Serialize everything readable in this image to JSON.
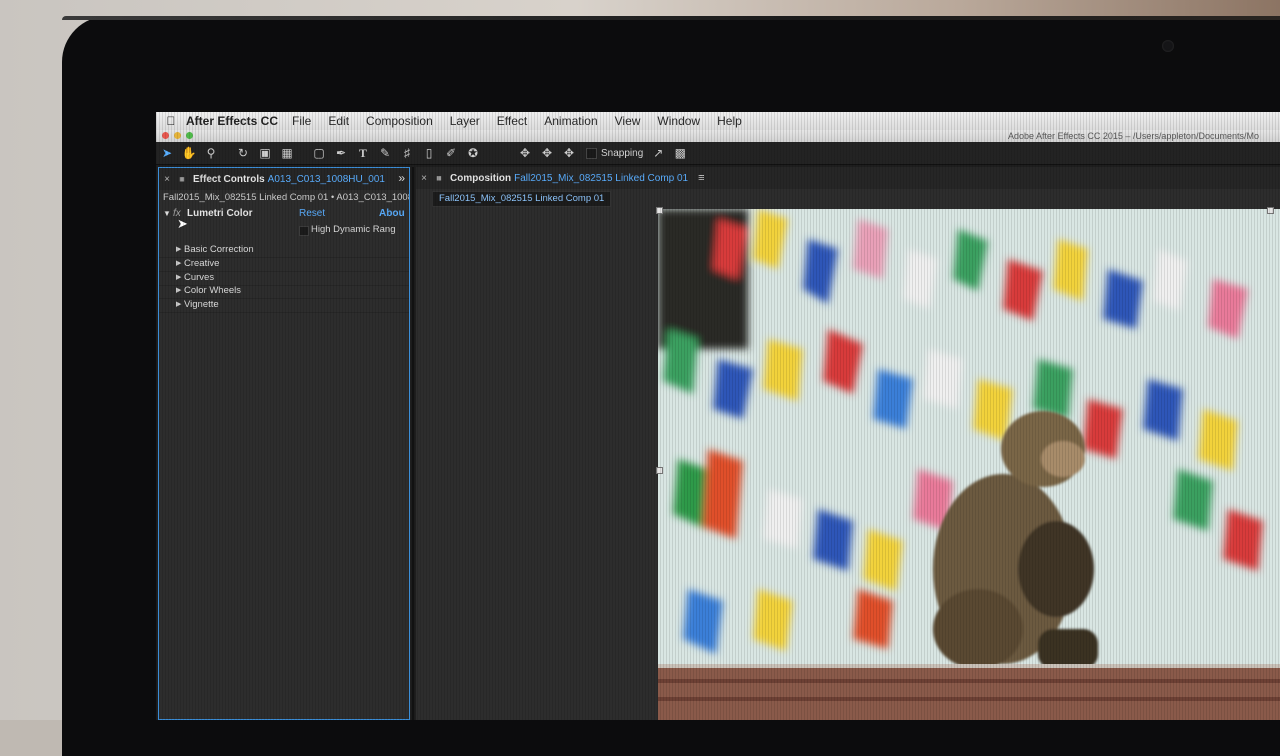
{
  "menubar": {
    "app_name": "After Effects CC",
    "items": [
      "File",
      "Edit",
      "Composition",
      "Layer",
      "Effect",
      "Animation",
      "View",
      "Window",
      "Help"
    ]
  },
  "window": {
    "title": "Adobe After Effects CC 2015 – /Users/appleton/Documents/Mo"
  },
  "toolbar": {
    "snapping_label": "Snapping",
    "snapping_enabled": false,
    "tools": [
      "selection-tool-icon",
      "hand-tool-icon",
      "zoom-tool-icon",
      "rotate-tool-icon",
      "camera-tool-icon",
      "pan-behind-tool-icon",
      "rectangle-tool-icon",
      "pen-tool-icon",
      "type-tool-icon",
      "brush-tool-icon",
      "clone-stamp-tool-icon",
      "eraser-tool-icon",
      "roto-brush-tool-icon",
      "puppet-pin-tool-icon"
    ]
  },
  "effect_controls": {
    "tab_label": "Effect Controls",
    "tab_layer": "A013_C013_1008HU_001",
    "path": "Fall2015_Mix_082515 Linked Comp 01 • A013_C013_1008",
    "effect": {
      "name": "Lumetri Color",
      "badge": "fx",
      "reset_label": "Reset",
      "about_label": "Abou",
      "hdr_label": "High Dynamic Rang",
      "sections": [
        "Basic Correction",
        "Creative",
        "Curves",
        "Color Wheels",
        "Vignette"
      ]
    }
  },
  "composition": {
    "tab_label": "Composition",
    "tab_comp": "Fall2015_Mix_082515 Linked Comp 01",
    "subtab": "Fall2015_Mix_082515 Linked Comp 01"
  },
  "colors": {
    "accent_blue": "#5aaeff",
    "panel_bg": "#2d2d2d",
    "focus_border": "#3b8ed8"
  }
}
